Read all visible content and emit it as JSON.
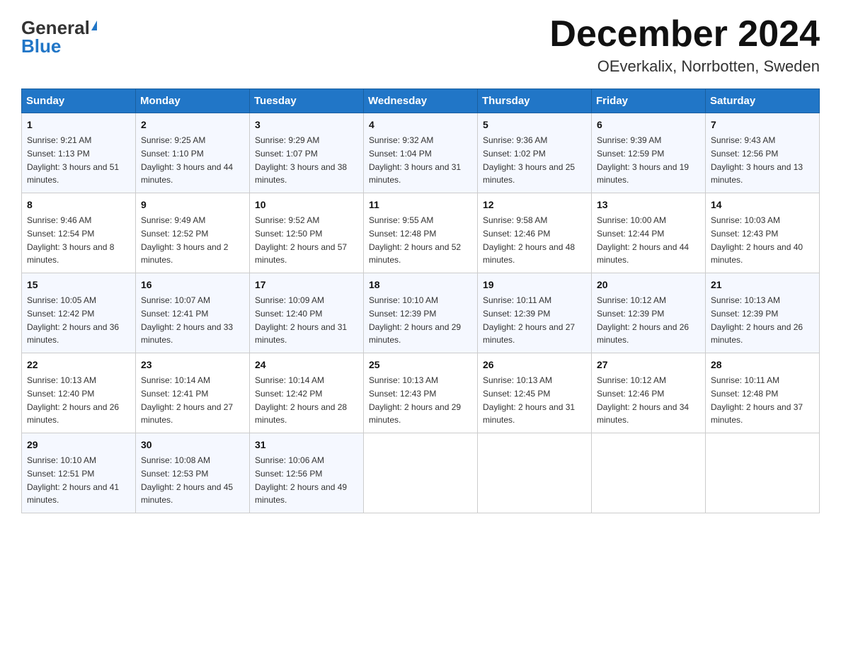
{
  "logo": {
    "general": "General",
    "blue": "Blue"
  },
  "title": "December 2024",
  "subtitle": "OEverkalix, Norrbotten, Sweden",
  "weekdays": [
    "Sunday",
    "Monday",
    "Tuesday",
    "Wednesday",
    "Thursday",
    "Friday",
    "Saturday"
  ],
  "weeks": [
    [
      {
        "day": "1",
        "sunrise": "9:21 AM",
        "sunset": "1:13 PM",
        "daylight": "3 hours and 51 minutes."
      },
      {
        "day": "2",
        "sunrise": "9:25 AM",
        "sunset": "1:10 PM",
        "daylight": "3 hours and 44 minutes."
      },
      {
        "day": "3",
        "sunrise": "9:29 AM",
        "sunset": "1:07 PM",
        "daylight": "3 hours and 38 minutes."
      },
      {
        "day": "4",
        "sunrise": "9:32 AM",
        "sunset": "1:04 PM",
        "daylight": "3 hours and 31 minutes."
      },
      {
        "day": "5",
        "sunrise": "9:36 AM",
        "sunset": "1:02 PM",
        "daylight": "3 hours and 25 minutes."
      },
      {
        "day": "6",
        "sunrise": "9:39 AM",
        "sunset": "12:59 PM",
        "daylight": "3 hours and 19 minutes."
      },
      {
        "day": "7",
        "sunrise": "9:43 AM",
        "sunset": "12:56 PM",
        "daylight": "3 hours and 13 minutes."
      }
    ],
    [
      {
        "day": "8",
        "sunrise": "9:46 AM",
        "sunset": "12:54 PM",
        "daylight": "3 hours and 8 minutes."
      },
      {
        "day": "9",
        "sunrise": "9:49 AM",
        "sunset": "12:52 PM",
        "daylight": "3 hours and 2 minutes."
      },
      {
        "day": "10",
        "sunrise": "9:52 AM",
        "sunset": "12:50 PM",
        "daylight": "2 hours and 57 minutes."
      },
      {
        "day": "11",
        "sunrise": "9:55 AM",
        "sunset": "12:48 PM",
        "daylight": "2 hours and 52 minutes."
      },
      {
        "day": "12",
        "sunrise": "9:58 AM",
        "sunset": "12:46 PM",
        "daylight": "2 hours and 48 minutes."
      },
      {
        "day": "13",
        "sunrise": "10:00 AM",
        "sunset": "12:44 PM",
        "daylight": "2 hours and 44 minutes."
      },
      {
        "day": "14",
        "sunrise": "10:03 AM",
        "sunset": "12:43 PM",
        "daylight": "2 hours and 40 minutes."
      }
    ],
    [
      {
        "day": "15",
        "sunrise": "10:05 AM",
        "sunset": "12:42 PM",
        "daylight": "2 hours and 36 minutes."
      },
      {
        "day": "16",
        "sunrise": "10:07 AM",
        "sunset": "12:41 PM",
        "daylight": "2 hours and 33 minutes."
      },
      {
        "day": "17",
        "sunrise": "10:09 AM",
        "sunset": "12:40 PM",
        "daylight": "2 hours and 31 minutes."
      },
      {
        "day": "18",
        "sunrise": "10:10 AM",
        "sunset": "12:39 PM",
        "daylight": "2 hours and 29 minutes."
      },
      {
        "day": "19",
        "sunrise": "10:11 AM",
        "sunset": "12:39 PM",
        "daylight": "2 hours and 27 minutes."
      },
      {
        "day": "20",
        "sunrise": "10:12 AM",
        "sunset": "12:39 PM",
        "daylight": "2 hours and 26 minutes."
      },
      {
        "day": "21",
        "sunrise": "10:13 AM",
        "sunset": "12:39 PM",
        "daylight": "2 hours and 26 minutes."
      }
    ],
    [
      {
        "day": "22",
        "sunrise": "10:13 AM",
        "sunset": "12:40 PM",
        "daylight": "2 hours and 26 minutes."
      },
      {
        "day": "23",
        "sunrise": "10:14 AM",
        "sunset": "12:41 PM",
        "daylight": "2 hours and 27 minutes."
      },
      {
        "day": "24",
        "sunrise": "10:14 AM",
        "sunset": "12:42 PM",
        "daylight": "2 hours and 28 minutes."
      },
      {
        "day": "25",
        "sunrise": "10:13 AM",
        "sunset": "12:43 PM",
        "daylight": "2 hours and 29 minutes."
      },
      {
        "day": "26",
        "sunrise": "10:13 AM",
        "sunset": "12:45 PM",
        "daylight": "2 hours and 31 minutes."
      },
      {
        "day": "27",
        "sunrise": "10:12 AM",
        "sunset": "12:46 PM",
        "daylight": "2 hours and 34 minutes."
      },
      {
        "day": "28",
        "sunrise": "10:11 AM",
        "sunset": "12:48 PM",
        "daylight": "2 hours and 37 minutes."
      }
    ],
    [
      {
        "day": "29",
        "sunrise": "10:10 AM",
        "sunset": "12:51 PM",
        "daylight": "2 hours and 41 minutes."
      },
      {
        "day": "30",
        "sunrise": "10:08 AM",
        "sunset": "12:53 PM",
        "daylight": "2 hours and 45 minutes."
      },
      {
        "day": "31",
        "sunrise": "10:06 AM",
        "sunset": "12:56 PM",
        "daylight": "2 hours and 49 minutes."
      },
      null,
      null,
      null,
      null
    ]
  ],
  "labels": {
    "sunrise_prefix": "Sunrise: ",
    "sunset_prefix": "Sunset: ",
    "daylight_prefix": "Daylight: "
  }
}
